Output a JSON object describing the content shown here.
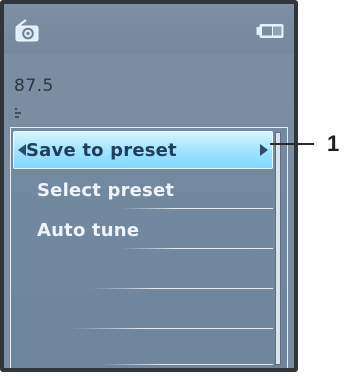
{
  "screen": {
    "frequency": "87.5",
    "icons": {
      "radio": "radio-icon",
      "battery": "battery-icon",
      "signal": "signal-icon"
    }
  },
  "menu": {
    "items": [
      {
        "label": "Save to preset",
        "selected": true
      },
      {
        "label": "Select preset",
        "selected": false
      },
      {
        "label": "Auto tune",
        "selected": false
      }
    ]
  },
  "callout": {
    "number": "1"
  },
  "colors": {
    "screen_bg": "#7a8c9f",
    "selection_highlight": "#a7e6ff",
    "menu_text": "#eef4fa",
    "frame": "#2f3538"
  }
}
